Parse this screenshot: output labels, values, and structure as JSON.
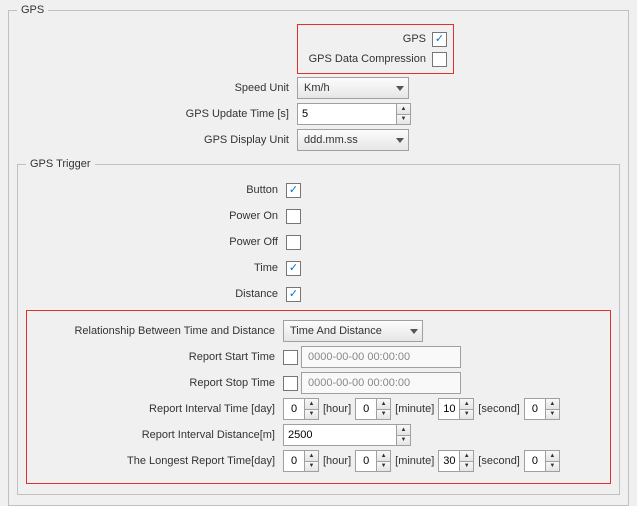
{
  "gps": {
    "legend": "GPS",
    "gps_label": "GPS",
    "gps_checked": true,
    "compression_label": "GPS Data Compression",
    "compression_checked": false,
    "speed_unit_label": "Speed Unit",
    "speed_unit_value": "Km/h",
    "update_time_label": "GPS Update Time [s]",
    "update_time_value": "5",
    "display_unit_label": "GPS Display Unit",
    "display_unit_value": "ddd.mm.ss"
  },
  "trigger": {
    "legend": "GPS Trigger",
    "button_label": "Button",
    "button_checked": true,
    "poweron_label": "Power On",
    "poweron_checked": false,
    "poweroff_label": "Power Off",
    "poweroff_checked": false,
    "time_label": "Time",
    "time_checked": true,
    "distance_label": "Distance",
    "distance_checked": true,
    "rel_label": "Relationship Between Time and Distance",
    "rel_value": "Time And Distance",
    "start_label": "Report Start Time",
    "start_checked": false,
    "start_value": "0000-00-00 00:00:00",
    "stop_label": "Report Stop Time",
    "stop_checked": false,
    "stop_value": "0000-00-00 00:00:00",
    "interval_time_label": "Report Interval Time [day]",
    "interval_time_day": "0",
    "interval_time_hour": "0",
    "interval_time_minute": "10",
    "interval_time_second": "0",
    "interval_dist_label": "Report Interval Distance[m]",
    "interval_dist_value": "2500",
    "longest_label": "The Longest Report Time[day]",
    "longest_day": "0",
    "longest_hour": "0",
    "longest_minute": "30",
    "longest_second": "0",
    "unit_hour": "[hour]",
    "unit_minute": "[minute]",
    "unit_second": "[second]"
  }
}
